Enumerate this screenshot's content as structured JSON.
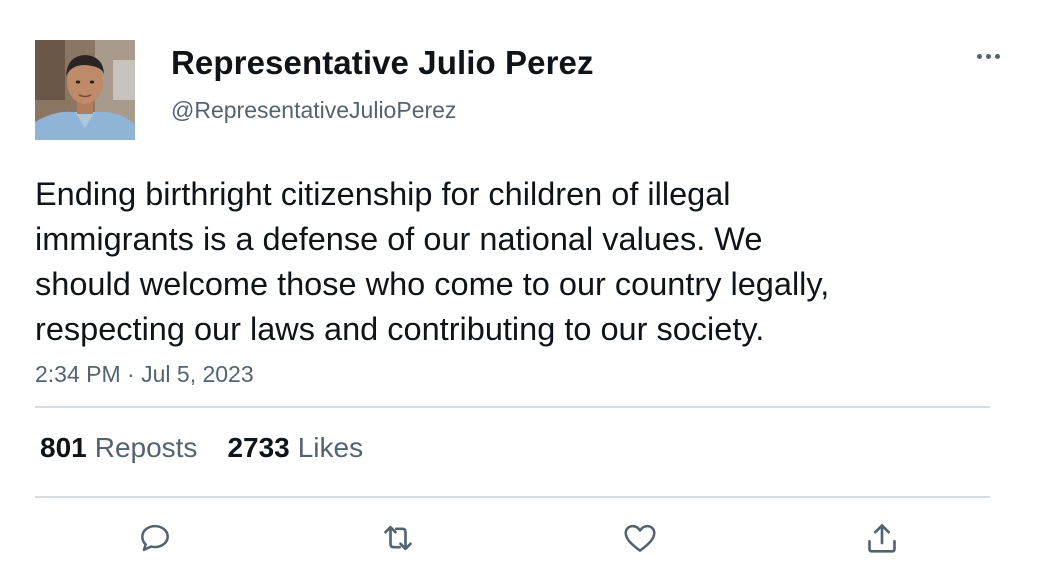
{
  "author": {
    "name": "Representative Julio Perez",
    "handle": "@RepresentativeJulioPerez"
  },
  "tweet": {
    "text": "Ending birthright citizenship for children of illegal\nimmigrants is a defense of our national values. We\nshould welcome those who come to our country legally,\nrespecting our laws and contributing to our society.",
    "time": "2:34 PM",
    "date": "Jul 5, 2023",
    "separator": "·"
  },
  "stats": {
    "reposts": {
      "count": "801",
      "label": "Reposts"
    },
    "likes": {
      "count": "2733",
      "label": "Likes"
    }
  },
  "icons": {
    "more": "more-horizontal-icon",
    "reply": "reply-bubble-icon",
    "repost": "repost-icon",
    "like": "heart-icon",
    "share": "share-upload-icon"
  },
  "colors": {
    "text": "#0f1419",
    "secondary": "#536471",
    "divider": "#d9dcde"
  }
}
